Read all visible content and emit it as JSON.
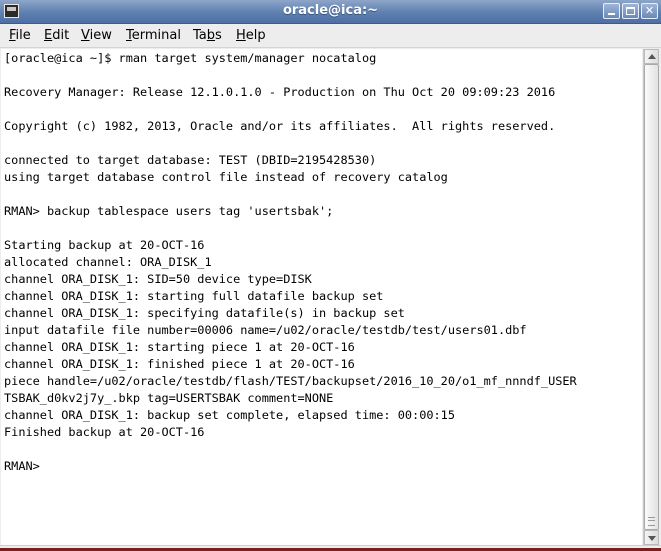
{
  "window": {
    "title": "oracle@ica:~",
    "icon": "terminal-icon"
  },
  "menu": [
    {
      "pre": "",
      "mnemonic": "F",
      "post": "ile"
    },
    {
      "pre": "",
      "mnemonic": "E",
      "post": "dit"
    },
    {
      "pre": "",
      "mnemonic": "V",
      "post": "iew"
    },
    {
      "pre": "",
      "mnemonic": "T",
      "post": "erminal"
    },
    {
      "pre": "Ta",
      "mnemonic": "b",
      "post": "s"
    },
    {
      "pre": "",
      "mnemonic": "H",
      "post": "elp"
    }
  ],
  "terminal": {
    "lines": [
      "[oracle@ica ~]$ rman target system/manager nocatalog",
      "",
      "Recovery Manager: Release 12.1.0.1.0 - Production on Thu Oct 20 09:09:23 2016",
      "",
      "Copyright (c) 1982, 2013, Oracle and/or its affiliates.  All rights reserved.",
      "",
      "connected to target database: TEST (DBID=2195428530)",
      "using target database control file instead of recovery catalog",
      "",
      "RMAN> backup tablespace users tag 'usertsbak';",
      "",
      "Starting backup at 20-OCT-16",
      "allocated channel: ORA_DISK_1",
      "channel ORA_DISK_1: SID=50 device type=DISK",
      "channel ORA_DISK_1: starting full datafile backup set",
      "channel ORA_DISK_1: specifying datafile(s) in backup set",
      "input datafile file number=00006 name=/u02/oracle/testdb/test/users01.dbf",
      "channel ORA_DISK_1: starting piece 1 at 20-OCT-16",
      "channel ORA_DISK_1: finished piece 1 at 20-OCT-16",
      "piece handle=/u02/oracle/testdb/flash/TEST/backupset/2016_10_20/o1_mf_nnndf_USER",
      "TSBAK_d0kv2j7y_.bkp tag=USERTSBAK comment=NONE",
      "channel ORA_DISK_1: backup set complete, elapsed time: 00:00:15",
      "Finished backup at 20-OCT-16",
      "",
      "RMAN> "
    ]
  },
  "scrollbar": {
    "up_icon": "arrow-up-icon",
    "down_icon": "arrow-down-icon"
  },
  "colors": {
    "titlebar": "#5f7fb0",
    "terminal_bg": "#ffffff",
    "terminal_fg": "#000000"
  }
}
